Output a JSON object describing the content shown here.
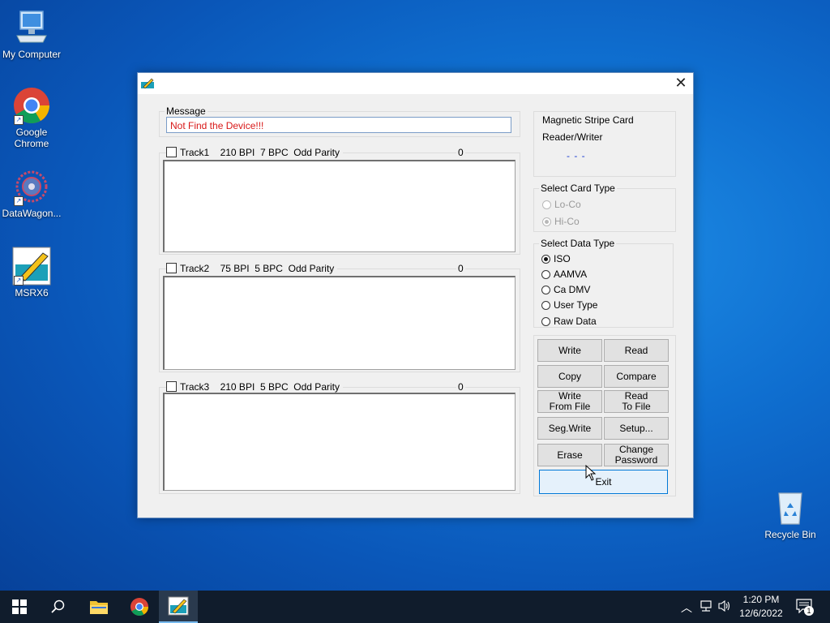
{
  "desktop": {
    "icons": [
      {
        "label": "My Computer"
      },
      {
        "label": "Google Chrome"
      },
      {
        "label": "DataWagon..."
      },
      {
        "label": "MSRX6"
      },
      {
        "label": "Recycle Bin"
      }
    ]
  },
  "window": {
    "message_label": "Message",
    "message_value": "Not Find the Device!!!",
    "tracks": [
      {
        "name": "Track1",
        "spec": "210 BPI  7 BPC  Odd Parity",
        "count": "0",
        "checked": false
      },
      {
        "name": "Track2",
        "spec": "75 BPI  5 BPC  Odd Parity",
        "count": "0",
        "checked": false
      },
      {
        "name": "Track3",
        "spec": "210 BPI  5 BPC  Odd Parity",
        "count": "0",
        "checked": false
      }
    ],
    "device": {
      "line1": "Magnetic Stripe Card",
      "line2": "Reader/Writer",
      "status": "- - -"
    },
    "card_type": {
      "label": "Select Card Type",
      "options": [
        "Lo-Co",
        "Hi-Co"
      ],
      "selected": "Hi-Co",
      "enabled": false
    },
    "data_type": {
      "label": "Select Data Type",
      "options": [
        "ISO",
        "AAMVA",
        "Ca DMV",
        "User Type",
        "Raw Data"
      ],
      "selected": "ISO"
    },
    "buttons": {
      "write": "Write",
      "read": "Read",
      "copy": "Copy",
      "compare": "Compare",
      "write_from_file_1": "Write",
      "write_from_file_2": "From File",
      "read_to_file_1": "Read",
      "read_to_file_2": "To File",
      "seg_write": "Seg.Write",
      "setup": "Setup...",
      "erase": "Erase",
      "change_password_1": "Change",
      "change_password_2": "Password",
      "exit": "Exit"
    }
  },
  "taskbar": {
    "time": "1:20 PM",
    "date": "12/6/2022",
    "notification_count": "1"
  },
  "colors": {
    "message_text": "#d81818",
    "accent": "#0078d7",
    "taskbar": "#101c2c"
  }
}
